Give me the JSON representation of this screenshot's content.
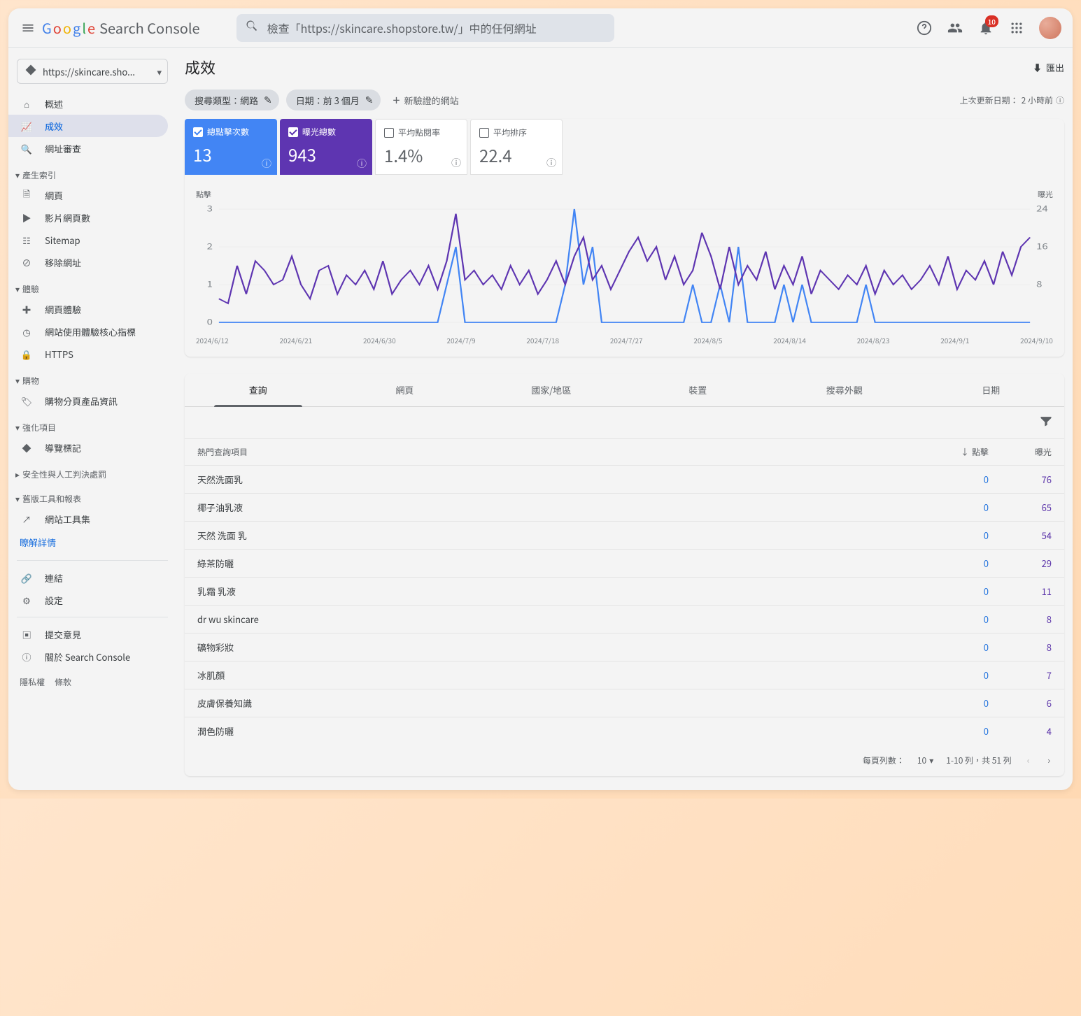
{
  "topbar": {
    "brand_sc": "Search Console",
    "search_placeholder": "檢查「https://skincare.shopstore.tw/」中的任何網址",
    "notification_count": "10"
  },
  "property": {
    "domain": "https://skincare.sho..."
  },
  "sidebar": {
    "overview": "概述",
    "performance": "成效",
    "url_inspect": "網址審查",
    "sec_indexing": "產生索引",
    "pages": "網頁",
    "video_pages": "影片網頁數",
    "sitemaps": "Sitemap",
    "removals": "移除網址",
    "sec_experience": "體驗",
    "page_experience": "網頁體驗",
    "core_web_vitals": "網站使用體驗核心指標",
    "https": "HTTPS",
    "sec_shopping": "購物",
    "shopping_info": "購物分頁產品資訊",
    "sec_enhancements": "強化項目",
    "breadcrumbs": "導覽標記",
    "security": "安全性與人工判決處罰",
    "sec_legacy": "舊版工具和報表",
    "toolset": "網站工具集",
    "learn_more": "瞭解詳情",
    "links": "連結",
    "settings": "設定",
    "feedback": "提交意見",
    "about": "關於 Search Console",
    "privacy": "隱私權",
    "terms": "條款"
  },
  "page": {
    "title": "成效",
    "export": "匯出",
    "chip_search_type": "搜尋類型：網路",
    "chip_date": "日期：前 3 個月",
    "add_new": "新驗證的網站",
    "last_update_prefix": "上次更新日期：",
    "last_update_time": "2 小時前"
  },
  "metrics": {
    "clicks_label": "總點擊次數",
    "clicks_value": "13",
    "impressions_label": "曝光總數",
    "impressions_value": "943",
    "ctr_label": "平均點閱率",
    "ctr_value": "1.4%",
    "position_label": "平均排序",
    "position_value": "22.4"
  },
  "chart_data": {
    "type": "line",
    "left_axis_label": "點擊",
    "right_axis_label": "曝光",
    "left_ylim": [
      0,
      3
    ],
    "right_ylim": [
      0,
      24
    ],
    "x_ticks": [
      "2024/6/12",
      "2024/6/21",
      "2024/6/30",
      "2024/7/9",
      "2024/7/18",
      "2024/7/27",
      "2024/8/5",
      "2024/8/14",
      "2024/8/23",
      "2024/9/1",
      "2024/9/10"
    ],
    "left_ticks": [
      0,
      1,
      2,
      3
    ],
    "right_ticks": [
      8,
      16,
      24
    ],
    "series": [
      {
        "name": "點擊",
        "color": "#4285f4",
        "axis": "left",
        "values": [
          0,
          0,
          0,
          0,
          0,
          0,
          0,
          0,
          0,
          0,
          0,
          0,
          0,
          0,
          0,
          0,
          0,
          0,
          0,
          0,
          0,
          0,
          0,
          0,
          0,
          1,
          2,
          0,
          0,
          0,
          0,
          0,
          0,
          0,
          0,
          0,
          0,
          0,
          1,
          3,
          1,
          2,
          0,
          0,
          0,
          0,
          0,
          0,
          0,
          0,
          0,
          0,
          1,
          0,
          0,
          1,
          0,
          2,
          0,
          0,
          0,
          0,
          1,
          0,
          1,
          0,
          0,
          0,
          0,
          0,
          0,
          1,
          0,
          0,
          0,
          0,
          0,
          0,
          0,
          0,
          0,
          0,
          0,
          0,
          0,
          0,
          0,
          0,
          0,
          0
        ]
      },
      {
        "name": "曝光",
        "color": "#5e35b1",
        "axis": "right",
        "values": [
          5,
          4,
          12,
          6,
          13,
          11,
          8,
          9,
          14,
          8,
          5,
          11,
          12,
          6,
          10,
          8,
          11,
          7,
          13,
          6,
          9,
          11,
          8,
          12,
          7,
          13,
          23,
          9,
          11,
          8,
          10,
          7,
          12,
          8,
          11,
          6,
          9,
          13,
          8,
          14,
          18,
          9,
          12,
          7,
          11,
          15,
          18,
          13,
          16,
          9,
          14,
          8,
          11,
          19,
          14,
          7,
          16,
          8,
          12,
          9,
          15,
          7,
          12,
          8,
          14,
          6,
          11,
          9,
          7,
          10,
          8,
          12,
          6,
          11,
          8,
          10,
          7,
          9,
          12,
          8,
          14,
          7,
          11,
          9,
          13,
          8,
          15,
          10,
          16,
          18
        ]
      }
    ]
  },
  "table": {
    "tabs": [
      "查詢",
      "網頁",
      "國家/地區",
      "裝置",
      "搜尋外觀",
      "日期"
    ],
    "active_tab": 0,
    "head_query": "熱門查詢項目",
    "head_clicks": "點擊",
    "head_impressions": "曝光",
    "rows": [
      {
        "q": "天然洗面乳",
        "c": 0,
        "i": 76
      },
      {
        "q": "椰子油乳液",
        "c": 0,
        "i": 65
      },
      {
        "q": "天然 洗面 乳",
        "c": 0,
        "i": 54
      },
      {
        "q": "綠茶防曬",
        "c": 0,
        "i": 29
      },
      {
        "q": "乳霜 乳液",
        "c": 0,
        "i": 11
      },
      {
        "q": "dr wu skincare",
        "c": 0,
        "i": 8
      },
      {
        "q": "礦物彩妝",
        "c": 0,
        "i": 8
      },
      {
        "q": "冰肌顏",
        "c": 0,
        "i": 7
      },
      {
        "q": "皮膚保養知識",
        "c": 0,
        "i": 6
      },
      {
        "q": "潤色防曬",
        "c": 0,
        "i": 4
      }
    ],
    "rows_per_page_label": "每頁列數：",
    "rows_per_page": "10",
    "range_text": "1-10 列，共 51 列"
  }
}
